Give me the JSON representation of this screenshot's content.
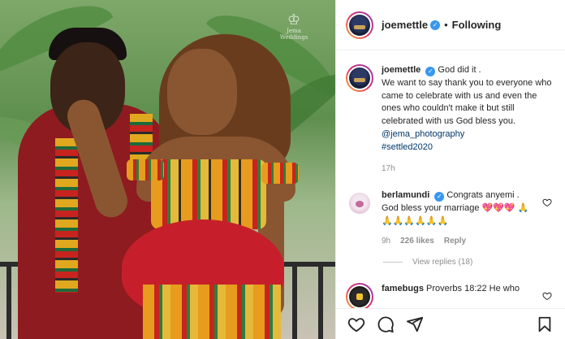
{
  "photo": {
    "watermark": "Jema Weddings",
    "colors": {
      "kente_gold": "#e79c1d",
      "kente_red": "#c7241f",
      "kente_green": "#2f7d3a",
      "dress_red": "#c61f2b",
      "suit_red": "#8e1b1f"
    }
  },
  "header": {
    "username": "joemettle",
    "separator": "•",
    "follow_state": "Following"
  },
  "caption": {
    "username": "joemettle",
    "text": "God did it .\nWe want to say thank you to everyone who came to celebrate with us and even the ones who couldn't make it but still celebrated with us God bless you.",
    "mention": "@jema_photography",
    "hashtag": "#settled2020",
    "time": "17h"
  },
  "comments": [
    {
      "username": "berlamundi",
      "text": "Congrats anyemi . God bless your marriage 💖💖💖 🙏🙏🙏🙏🙏🙏🙏",
      "time": "9h",
      "likes": "226 likes",
      "reply_label": "Reply",
      "view_replies": "View replies (18)"
    },
    {
      "username": "famebugs",
      "text": "Proverbs 18:22 He who"
    }
  ],
  "accent": "#3897f0",
  "icons": [
    "heart-icon",
    "comment-icon",
    "share-icon",
    "bookmark-icon",
    "verified-icon"
  ]
}
